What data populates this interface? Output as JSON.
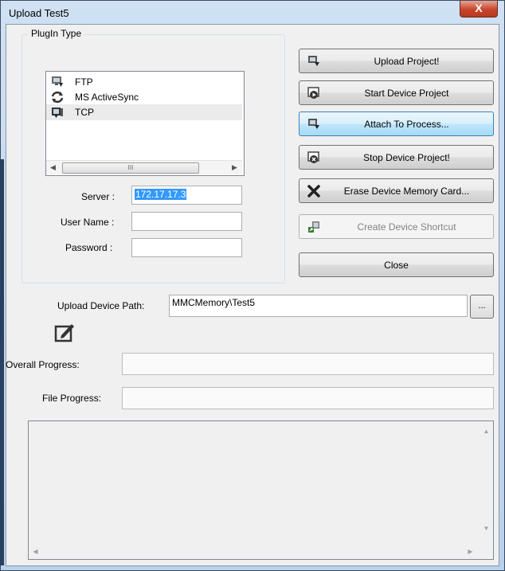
{
  "window": {
    "title": "Upload Test5",
    "close_glyph": "X"
  },
  "plugin_group": {
    "label": "PlugIn Type",
    "items": [
      {
        "label": "FTP",
        "icon": "ftp-icon",
        "selected": false
      },
      {
        "label": "MS ActiveSync",
        "icon": "activesync-icon",
        "selected": false
      },
      {
        "label": "TCP",
        "icon": "tcp-icon",
        "selected": true
      }
    ],
    "scroll_left": "◀",
    "scroll_right": "▶",
    "scroll_thumb": "III"
  },
  "connection": {
    "server_label": "Server :",
    "server_value": "172.17.17.3",
    "username_label": "User Name :",
    "username_value": "",
    "password_label": "Password :",
    "password_value": ""
  },
  "buttons": {
    "upload_project": "Upload Project!",
    "start_device_project": "Start Device Project",
    "attach_to_process": "Attach To Process...",
    "stop_device_project": "Stop Device Project!",
    "erase_memory_card": "Erase Device Memory Card...",
    "create_shortcut": "Create Device Shortcut",
    "close": "Close"
  },
  "upload_path": {
    "label": "Upload Device Path:",
    "value": "MMCMemory\\Test5",
    "browse_label": "..."
  },
  "progress": {
    "overall_label": "Overall Progress:",
    "overall_value": 0,
    "file_label": "File Progress:",
    "file_value": 0
  },
  "log": {
    "text": "",
    "scroll_up": "▲",
    "scroll_down": "▼",
    "scroll_left": "◀",
    "scroll_right": "▶"
  },
  "colors": {
    "titlebar": "#b9d1ea",
    "close_button": "#c7452b",
    "selection": "#3399ff",
    "hover_button": "#bee6fd",
    "progress_fill": "#06b025"
  }
}
